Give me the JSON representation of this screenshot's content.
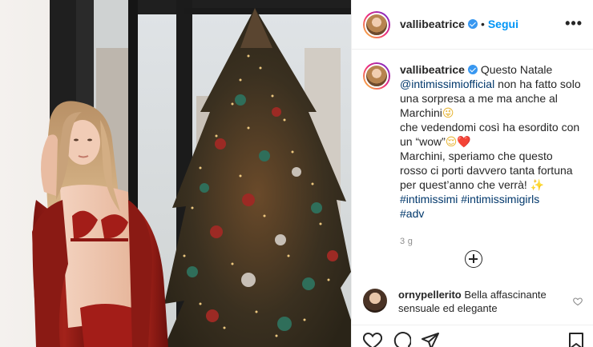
{
  "post": {
    "username": "vallibeatrice",
    "follow_label": "Segui",
    "separator": "•",
    "more_label": "•••"
  },
  "caption": {
    "username": "vallibeatrice",
    "line1_text": "Questo Natale",
    "mention": "@intimissimiofficial",
    "line2_text": "non ha fatto solo una sorpresa a me ma anche al Marchini",
    "emoji_1": "😜",
    "line3_text": "che vedendomi così ha esordito con un “wow”",
    "emoji_2": "😌",
    "emoji_3": "❤️",
    "line4_text": "Marchini, speriamo che questo rosso ci porti davvero tanta fortuna per quest’anno che verrà!",
    "emoji_4": "✨",
    "hashtag_1": "#intimissimi",
    "hashtag_2": "#intimissimigirls",
    "hashtag_3": "#adv",
    "age": "3 g"
  },
  "comment": {
    "username": "ornypellerito",
    "text": "Bella affascinante sensuale ed elegante"
  },
  "icons": {
    "verified": "verified-badge-icon",
    "load_more": "plus-circle-icon",
    "like": "heart-icon",
    "comment": "comment-bubble-icon",
    "share": "paper-plane-icon",
    "save": "bookmark-icon"
  },
  "colors": {
    "link": "#00376b",
    "follow": "#0095f6",
    "verified": "#3897f0",
    "meta": "#8e8e8e",
    "text": "#262626"
  }
}
